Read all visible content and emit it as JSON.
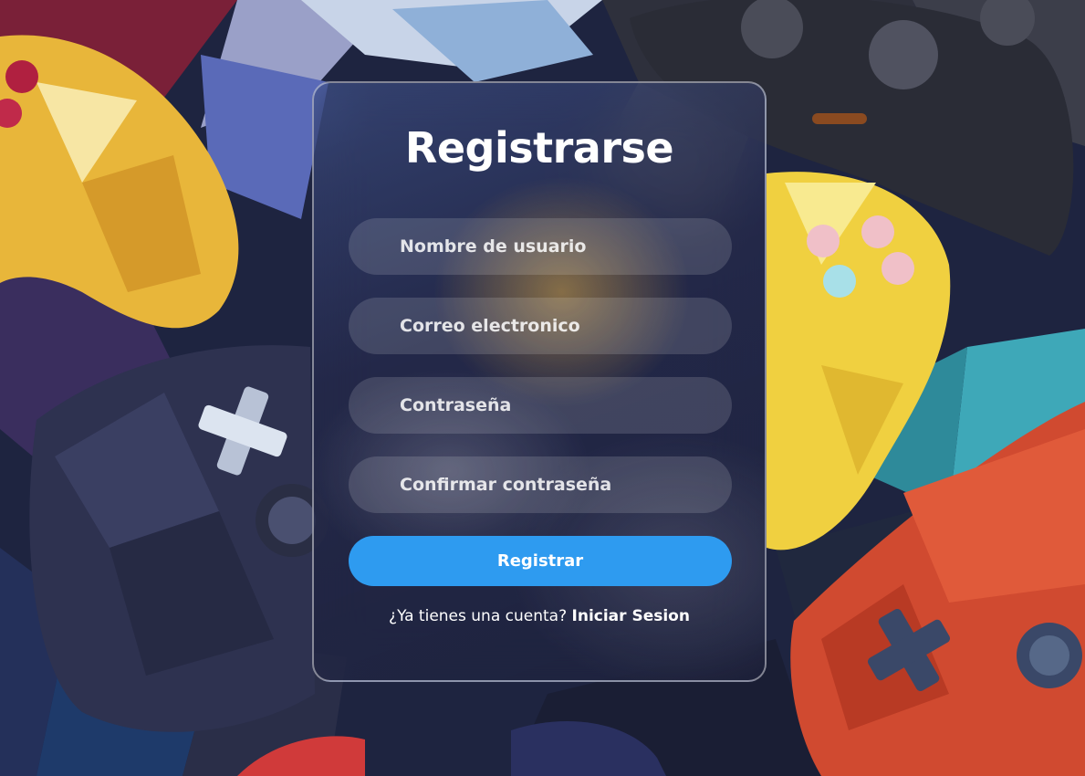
{
  "form": {
    "title": "Registrarse",
    "fields": [
      {
        "placeholder": "Nombre de usuario",
        "value": ""
      },
      {
        "placeholder": "Correo electronico",
        "value": ""
      },
      {
        "placeholder": "Contraseña",
        "value": ""
      },
      {
        "placeholder": "Confirmar contraseña",
        "value": ""
      }
    ],
    "submit_label": "Registrar",
    "footer_text": "¿Ya tienes una cuenta?",
    "footer_link": "Iniciar Sesion"
  },
  "colors": {
    "accent": "#2e9bf0",
    "text": "#ffffff"
  },
  "background": {
    "image_subject": "low-poly game controllers"
  }
}
